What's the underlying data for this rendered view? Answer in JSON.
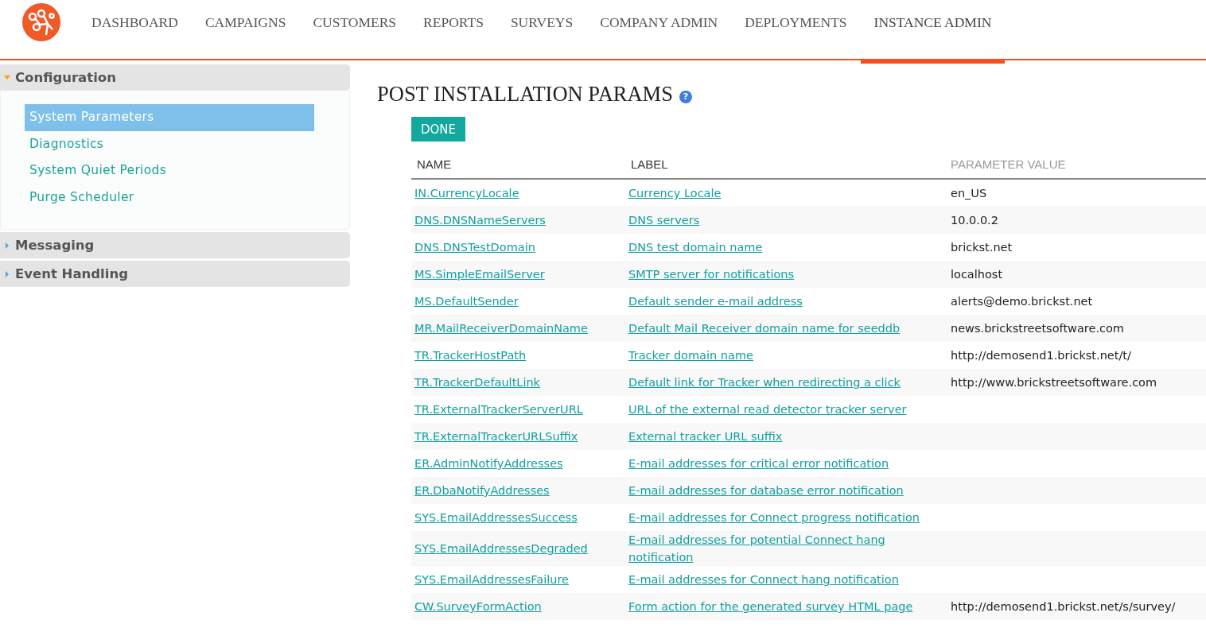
{
  "nav": [
    {
      "label": "DASHBOARD",
      "selected": false
    },
    {
      "label": "CAMPAIGNS",
      "selected": false
    },
    {
      "label": "CUSTOMERS",
      "selected": false
    },
    {
      "label": "REPORTS",
      "selected": false
    },
    {
      "label": "SURVEYS",
      "selected": false
    },
    {
      "label": "COMPANY ADMIN",
      "selected": false
    },
    {
      "label": "DEPLOYMENTS",
      "selected": false
    },
    {
      "label": "INSTANCE ADMIN",
      "selected": true
    }
  ],
  "sidebar": [
    {
      "title": "Configuration",
      "expanded": true,
      "items": [
        {
          "label": "System Parameters",
          "selected": true
        },
        {
          "label": "Diagnostics",
          "selected": false
        },
        {
          "label": "System Quiet Periods",
          "selected": false
        },
        {
          "label": "Purge Scheduler",
          "selected": false
        }
      ]
    },
    {
      "title": "Messaging",
      "expanded": false
    },
    {
      "title": "Event Handling",
      "expanded": false
    }
  ],
  "page_title": "POST INSTALLATION PARAMS",
  "help_button": "?",
  "done_button": "DONE",
  "table": {
    "columns": [
      "NAME",
      "LABEL",
      "PARAMETER VALUE"
    ],
    "rows": [
      {
        "name": "IN.CurrencyLocale",
        "label": "Currency Locale",
        "value": "en_US"
      },
      {
        "name": "DNS.DNSNameServers",
        "label": "DNS servers",
        "value": "10.0.0.2"
      },
      {
        "name": "DNS.DNSTestDomain",
        "label": "DNS test domain name",
        "value": "brickst.net"
      },
      {
        "name": "MS.SimpleEmailServer",
        "label": "SMTP server for notifications",
        "value": "localhost"
      },
      {
        "name": "MS.DefaultSender",
        "label": "Default sender e-mail address",
        "value": "alerts@demo.brickst.net"
      },
      {
        "name": "MR.MailReceiverDomainName",
        "label": "Default Mail Receiver domain name for seeddb",
        "value": "news.brickstreetsoftware.com"
      },
      {
        "name": "TR.TrackerHostPath",
        "label": "Tracker domain name",
        "value": "http://demosend1.brickst.net/t/"
      },
      {
        "name": "TR.TrackerDefaultLink",
        "label": "Default link for Tracker when redirecting a click",
        "value": "http://www.brickstreetsoftware.com"
      },
      {
        "name": "TR.ExternalTrackerServerURL",
        "label": "URL of the external read detector tracker server"
      },
      {
        "name": "TR.ExternalTrackerURLSuffix",
        "label": "External tracker URL suffix"
      },
      {
        "name": "ER.AdminNotifyAddresses",
        "label": "E-mail addresses for critical error notification"
      },
      {
        "name": "ER.DbaNotifyAddresses",
        "label": "E-mail addresses for database error notification"
      },
      {
        "name": "SYS.EmailAddressesSuccess",
        "label": "E-mail addresses for Connect progress notification"
      },
      {
        "name": "SYS.EmailAddressesDegraded",
        "label": "E-mail addresses for potential Connect hang notification"
      },
      {
        "name": "SYS.EmailAddressesFailure",
        "label": "E-mail addresses for Connect hang notification"
      },
      {
        "name": "CW.SurveyFormAction",
        "label": "Form action for the generated survey HTML page",
        "value": "http://demosend1.brickst.net/s/survey/"
      }
    ]
  }
}
